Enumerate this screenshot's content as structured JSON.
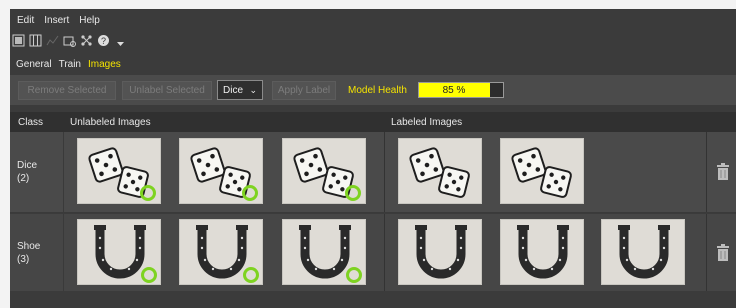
{
  "menu": {
    "edit": "Edit",
    "insert": "Insert",
    "help": "Help"
  },
  "toolbar_icons": [
    "grid-icon",
    "columns-icon",
    "chart-icon",
    "snapshot-icon",
    "network-icon",
    "help-icon",
    "dropdown-icon"
  ],
  "tabs": [
    {
      "label": "General",
      "active": false
    },
    {
      "label": "Train",
      "active": false
    },
    {
      "label": "Images",
      "active": true
    }
  ],
  "actions": {
    "remove_selected": "Remove Selected",
    "unlabel_selected": "Unlabel Selected",
    "class_select": "Dice",
    "apply_label": "Apply Label",
    "model_health_label": "Model Health",
    "model_health_value": "85 %",
    "model_health_fraction": 0.85
  },
  "table": {
    "headers": {
      "class": "Class",
      "unlabeled": "Unlabeled Images",
      "labeled": "Labeled Images"
    },
    "rows": [
      {
        "name": "Dice",
        "count": "(2)",
        "unlabeled": [
          "dice-image",
          "dice-image",
          "dice-image"
        ],
        "labeled": [
          "dice-image",
          "dice-image"
        ]
      },
      {
        "name": "Shoe",
        "count": "(3)",
        "unlabeled": [
          "horseshoe-image",
          "horseshoe-image",
          "horseshoe-image"
        ],
        "labeled": [
          "horseshoe-image",
          "horseshoe-image",
          "horseshoe-image"
        ]
      }
    ]
  },
  "colors": {
    "accent": "#f5e400",
    "health_fill": "#ffff00",
    "pending_ring": "#7ed321",
    "panel": "#3b3b3b"
  }
}
